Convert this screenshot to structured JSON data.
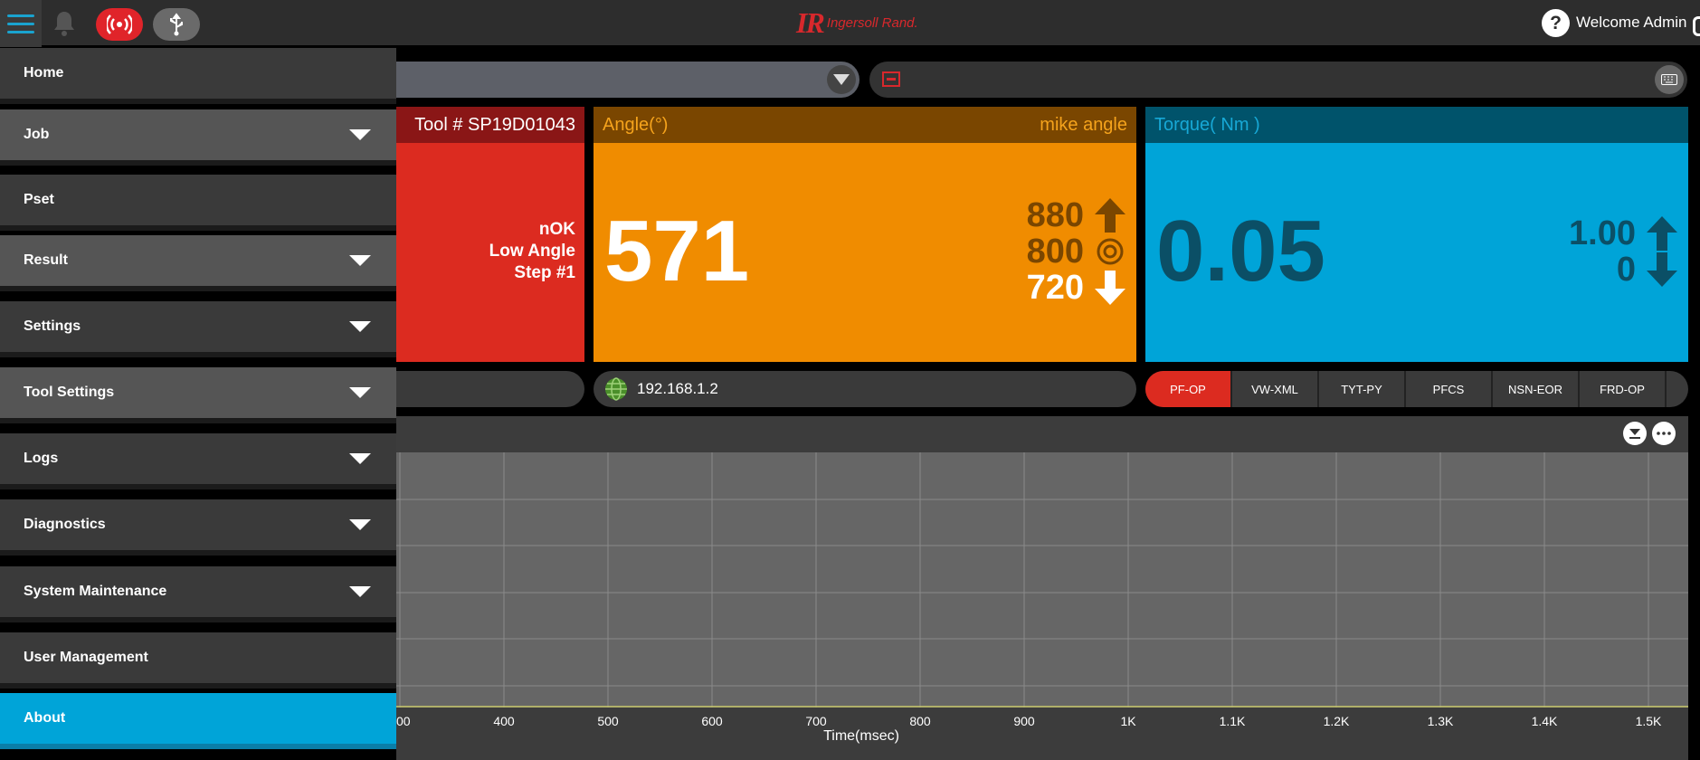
{
  "header": {
    "brand": "Ingersoll Rand.",
    "brand_mark": "IR",
    "help": "?",
    "welcome": "Welcome Admin"
  },
  "tool_panel": {
    "title": "Tool # SP19D01043",
    "status": [
      "nOK",
      "Low Angle",
      "Step #1"
    ],
    "color": "#dc2b20"
  },
  "angle_panel": {
    "label": "Angle(°)",
    "name": "mike angle",
    "value": "571",
    "high": "880",
    "target": "800",
    "low": "720",
    "color": "#f08c00"
  },
  "torque_panel": {
    "label": "Torque( Nm )",
    "value": "0.05",
    "high": "1.00",
    "low": "0",
    "color": "#00a4d8"
  },
  "network": {
    "ip": "192.168.1.2"
  },
  "protocols": [
    "PF-OP",
    "VW-XML",
    "TYT-PY",
    "PFCS",
    "NSN-EOR",
    "FRD-OP"
  ],
  "active_protocol": "PF-OP",
  "chart": {
    "x_ticks": [
      "00",
      "400",
      "500",
      "600",
      "700",
      "800",
      "900",
      "1K",
      "1.1K",
      "1.2K",
      "1.3K",
      "1.4K",
      "1.5K"
    ],
    "xlabel": "Time(msec)"
  },
  "menu": {
    "items": [
      {
        "label": "Home",
        "expandable": false
      },
      {
        "label": "Job",
        "expandable": true
      },
      {
        "label": "Pset",
        "expandable": false
      },
      {
        "label": "Result",
        "expandable": true
      },
      {
        "label": "Settings",
        "expandable": true
      },
      {
        "label": "Tool Settings",
        "expandable": true
      },
      {
        "label": "Logs",
        "expandable": true
      },
      {
        "label": "Diagnostics",
        "expandable": true
      },
      {
        "label": "System Maintenance",
        "expandable": true
      },
      {
        "label": "User Management",
        "expandable": false
      },
      {
        "label": "About",
        "expandable": false
      }
    ],
    "selected": "About"
  }
}
